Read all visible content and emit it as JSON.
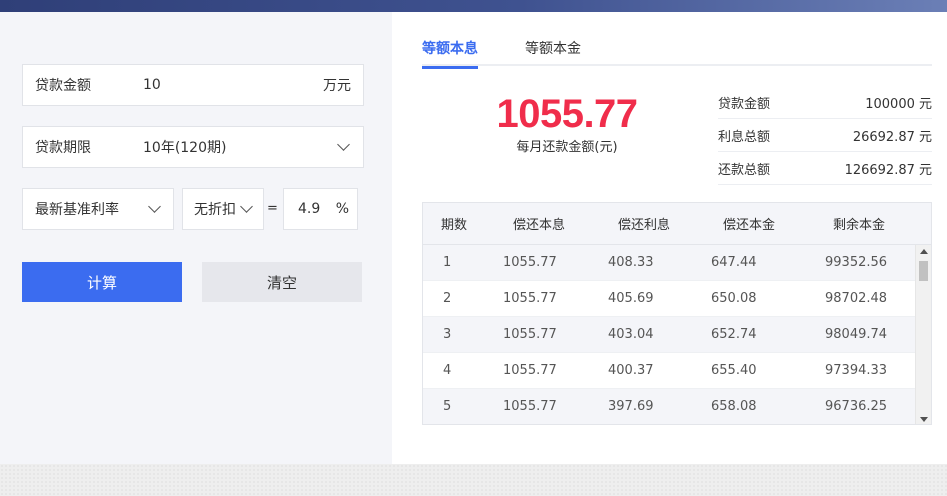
{
  "form": {
    "loan_amount": {
      "label": "贷款金额",
      "value": "10",
      "unit": "万元"
    },
    "loan_term": {
      "label": "贷款期限",
      "value": "10年(120期)"
    },
    "rate_type": {
      "value": "最新基准利率"
    },
    "discount": {
      "value": "无折扣"
    },
    "equals": "=",
    "rate": {
      "value": "4.9",
      "unit": "%"
    },
    "calc_button": "计算",
    "clear_button": "清空"
  },
  "result": {
    "tabs": [
      "等额本息",
      "等额本金"
    ],
    "active_tab": 0,
    "monthly_payment": "1055.77",
    "monthly_caption": "每月还款金额(元)",
    "summary": [
      {
        "label": "贷款金额",
        "value": "100000 元"
      },
      {
        "label": "利息总额",
        "value": "26692.87 元"
      },
      {
        "label": "还款总额",
        "value": "126692.87 元"
      }
    ],
    "table": {
      "headers": [
        "期数",
        "偿还本息",
        "偿还利息",
        "偿还本金",
        "剩余本金"
      ],
      "rows": [
        [
          "1",
          "1055.77",
          "408.33",
          "647.44",
          "99352.56"
        ],
        [
          "2",
          "1055.77",
          "405.69",
          "650.08",
          "98702.48"
        ],
        [
          "3",
          "1055.77",
          "403.04",
          "652.74",
          "98049.74"
        ],
        [
          "4",
          "1055.77",
          "400.37",
          "655.40",
          "97394.33"
        ],
        [
          "5",
          "1055.77",
          "397.69",
          "658.08",
          "96736.25"
        ]
      ]
    }
  },
  "colors": {
    "accent": "#3b6cf0",
    "amount_red": "#f02d4b",
    "header_bar": "#2f3f78"
  }
}
